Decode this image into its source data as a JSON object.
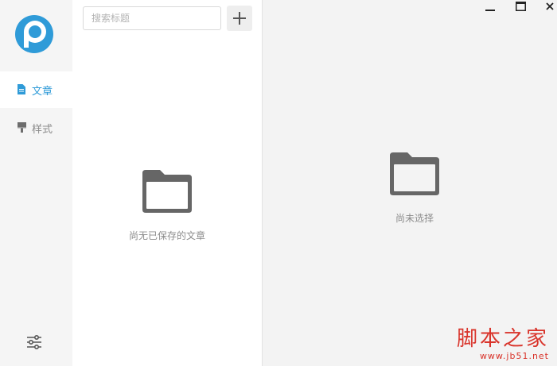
{
  "sidebar": {
    "nav": [
      {
        "label": "文章",
        "icon": "document-icon",
        "active": true
      },
      {
        "label": "样式",
        "icon": "brush-icon",
        "active": false
      }
    ],
    "settings_icon": "sliders-icon",
    "brand_color": "#2f9bd8"
  },
  "list_pane": {
    "search": {
      "placeholder": "搜索标题",
      "value": ""
    },
    "add_button_icon": "plus-icon",
    "empty_state": {
      "icon": "folder-icon",
      "text": "尚无已保存的文章"
    }
  },
  "detail_pane": {
    "empty_state": {
      "icon": "folder-icon",
      "text": "尚未选择"
    }
  },
  "window_controls": [
    "minimize-icon",
    "maximize-icon",
    "close-icon"
  ],
  "watermark": {
    "title": "脚本之家",
    "url": "www.jb51.net"
  }
}
